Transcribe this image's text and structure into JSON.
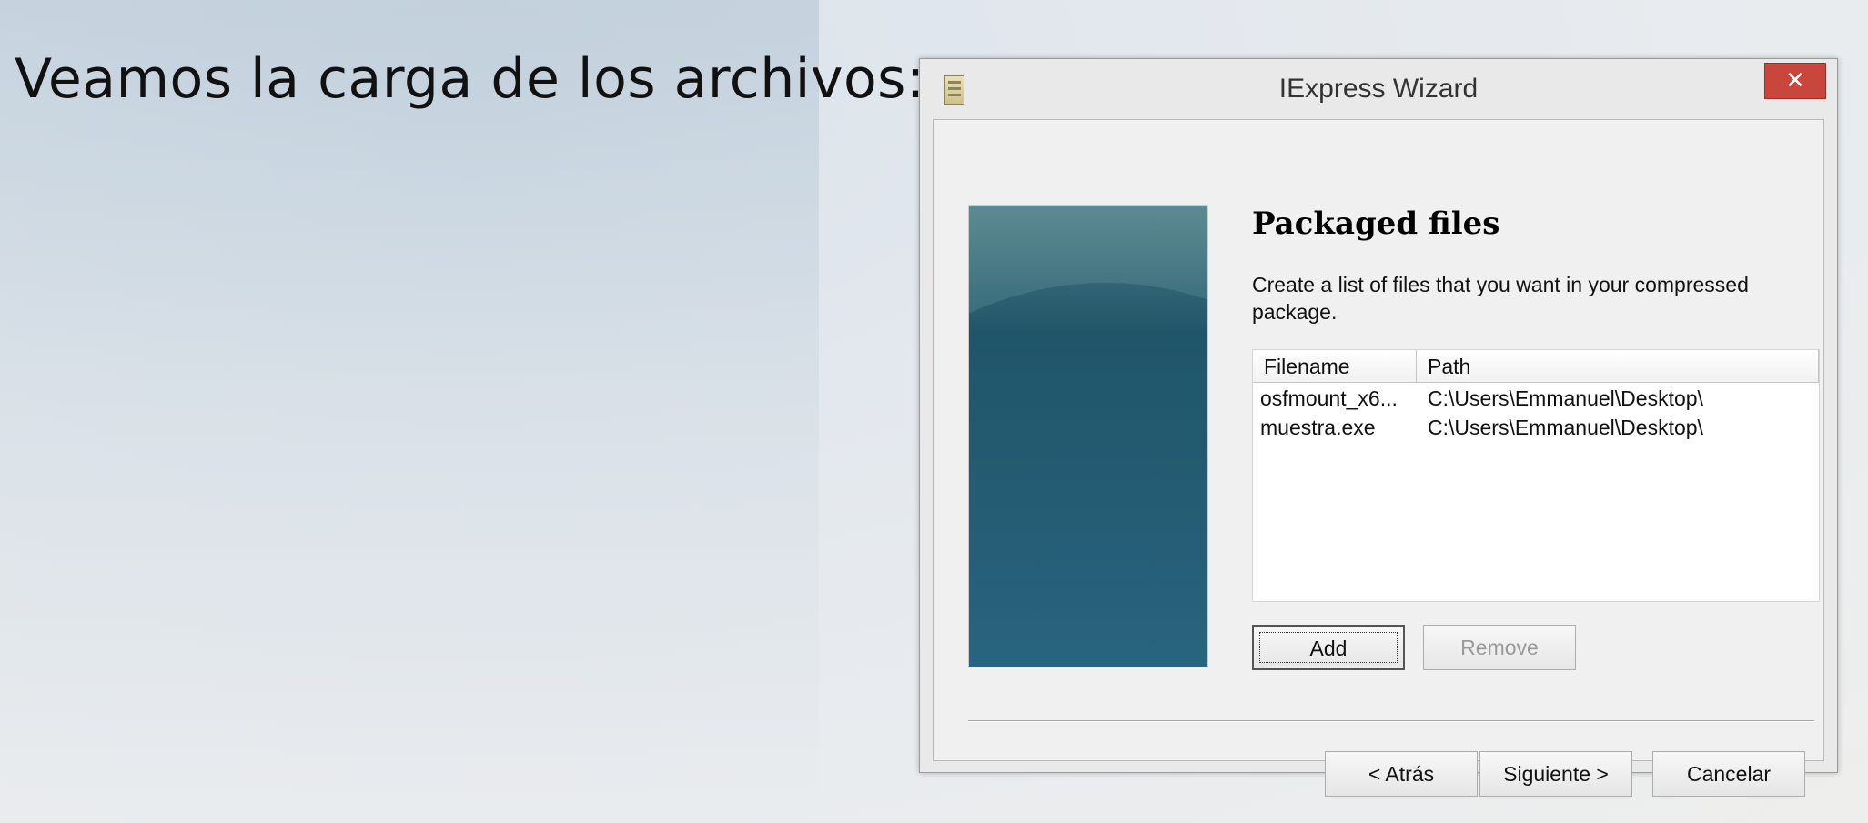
{
  "slide": {
    "title": "Veamos la carga de los archivos:"
  },
  "window": {
    "title": "IExpress Wizard",
    "close_label": "✕",
    "heading": "Packaged files",
    "description": "Create a list of files that you want in your compressed package.",
    "columns": [
      "Filename",
      "Path"
    ],
    "files": [
      {
        "name": "osfmount_x6...",
        "path": "C:\\Users\\Emmanuel\\Desktop\\"
      },
      {
        "name": "muestra.exe",
        "path": "C:\\Users\\Emmanuel\\Desktop\\"
      }
    ],
    "buttons": {
      "add": "Add",
      "remove": "Remove",
      "back": "< Atrás",
      "next": "Siguiente >",
      "cancel": "Cancelar"
    }
  }
}
